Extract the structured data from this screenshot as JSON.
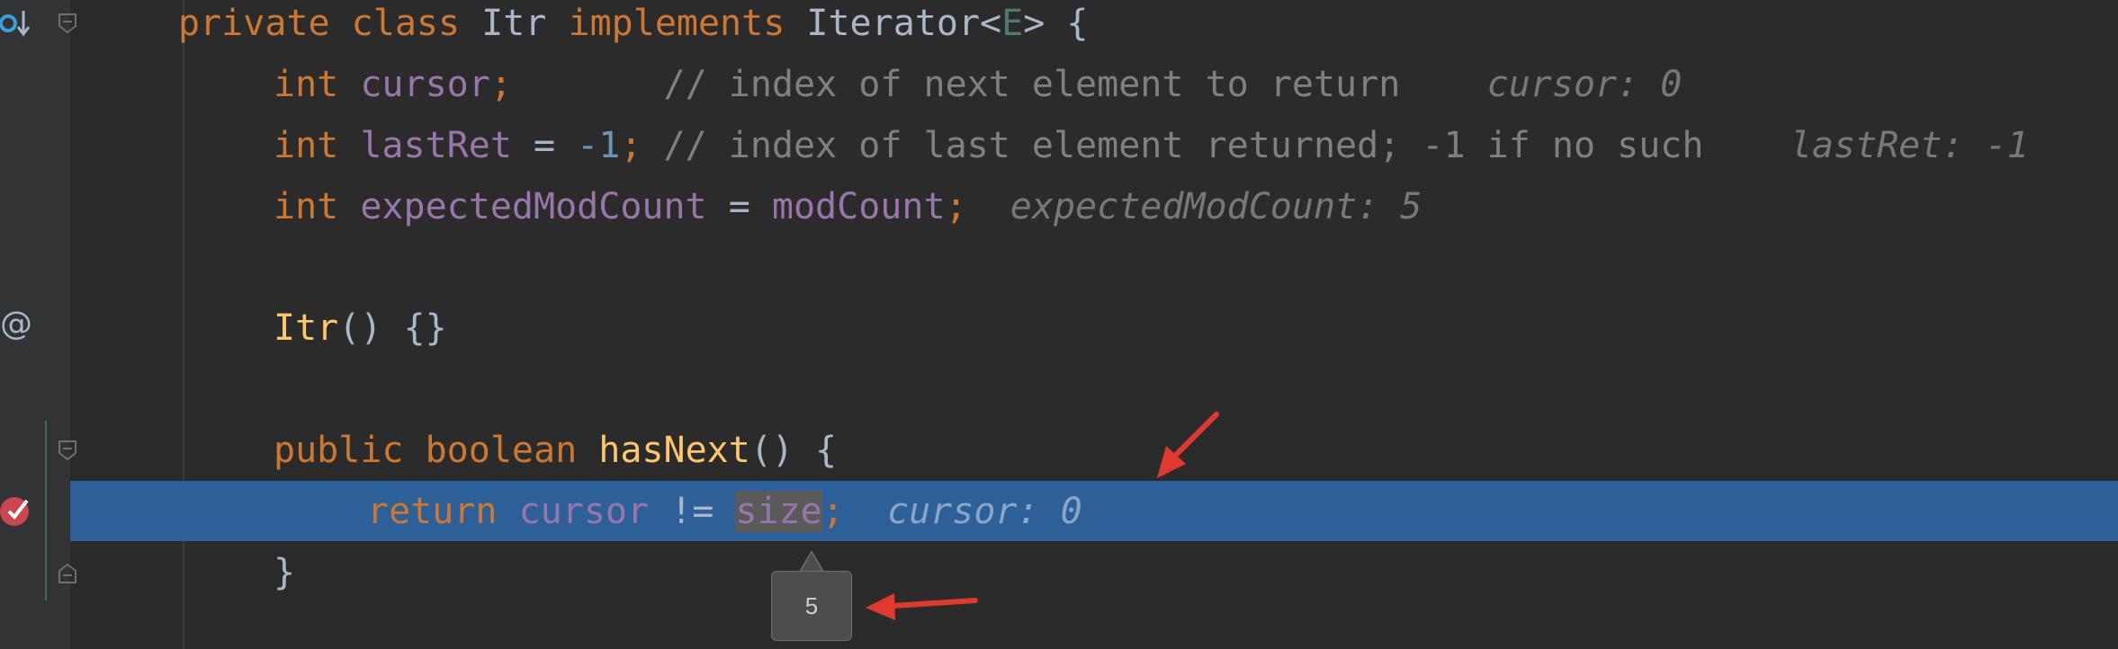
{
  "editor": {
    "lines": [
      {
        "id": "class-decl",
        "tokens": [
          [
            "kw",
            "private class "
          ],
          [
            "cls",
            "Itr "
          ],
          [
            "kw",
            "implements "
          ],
          [
            "cls",
            "Iterator<"
          ],
          [
            "typeparam",
            "E"
          ],
          [
            "cls",
            "> {"
          ]
        ]
      },
      {
        "id": "cursor-decl",
        "tokens": [
          [
            "kw",
            "int "
          ],
          [
            "field",
            "cursor"
          ],
          [
            "kw",
            ";"
          ],
          [
            "comment",
            "       // index of next element to return  "
          ]
        ],
        "hint": "cursor: 0"
      },
      {
        "id": "lastret-decl",
        "tokens": [
          [
            "kw",
            "int "
          ],
          [
            "field",
            "lastRet"
          ],
          [
            "plain",
            " = "
          ],
          [
            "num",
            "-1"
          ],
          [
            "kw",
            ";"
          ],
          [
            "comment",
            " // index of last element returned; -1 if no such  "
          ]
        ],
        "hint": "lastRet: -1"
      },
      {
        "id": "expected-decl",
        "tokens": [
          [
            "kw",
            "int "
          ],
          [
            "field",
            "expectedModCount"
          ],
          [
            "plain",
            " = "
          ],
          [
            "field",
            "modCount"
          ],
          [
            "kw",
            ";"
          ]
        ],
        "hint": "expectedModCount: 5"
      },
      {
        "id": "ctor",
        "tokens": [
          [
            "method",
            "Itr"
          ],
          [
            "plain",
            "() {}"
          ]
        ]
      },
      {
        "id": "hasnext-decl",
        "tokens": [
          [
            "kw",
            "public boolean "
          ],
          [
            "method",
            "hasNext"
          ],
          [
            "plain",
            "() {"
          ]
        ]
      },
      {
        "id": "return-line",
        "tokens": [
          [
            "kw",
            "return "
          ],
          [
            "field",
            "cursor"
          ],
          [
            "plain",
            " != "
          ],
          [
            "field",
            "size"
          ],
          [
            "kw",
            ";"
          ]
        ],
        "hint": "cursor: 0"
      },
      {
        "id": "close-brace",
        "tokens": [
          [
            "plain",
            "}"
          ]
        ]
      }
    ]
  },
  "tooltip": {
    "value": "5"
  },
  "gutter": {
    "annotation_symbol": "@"
  },
  "colors": {
    "background": "#2b2b2b",
    "execution_line": "#2d5f99",
    "arrow": "#e03a2f",
    "breakpoint": "#c9474f"
  }
}
